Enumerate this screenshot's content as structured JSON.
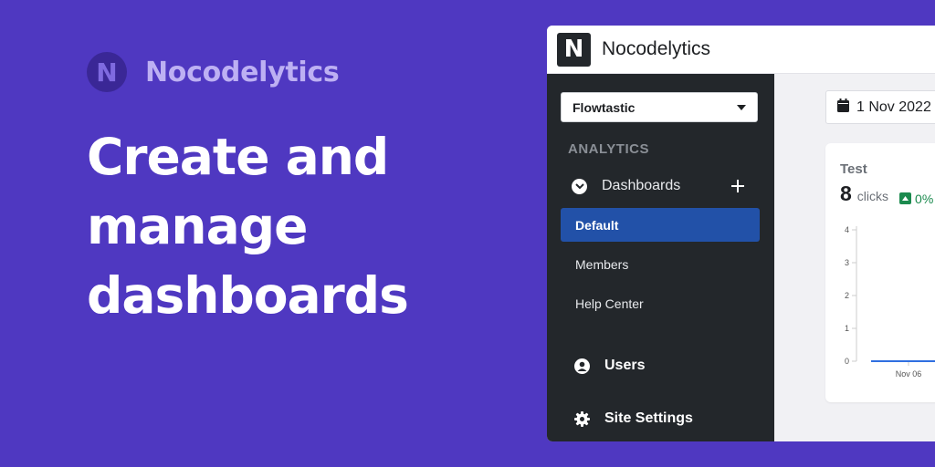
{
  "brand": {
    "logo_letter": "N",
    "name": "Nocodelytics"
  },
  "headline": {
    "lines": [
      "Create and",
      "manage",
      "dashboards"
    ]
  },
  "app": {
    "logo_letter": "N",
    "title": "Nocodelytics",
    "site_select": {
      "value": "Flowtastic"
    },
    "section_title": "ANALYTICS",
    "dashboards_label": "Dashboards",
    "nav": {
      "default": "Default",
      "members": "Members",
      "help_center": "Help Center"
    },
    "users_label": "Users",
    "site_settings_label": "Site Settings",
    "date_range": "1 Nov 2022",
    "card": {
      "title": "Test",
      "metric_value": "8",
      "metric_unit": "clicks",
      "change": "0%"
    }
  },
  "colors": {
    "background": "#4f38c1",
    "sidebar": "#23272b",
    "active": "#2251a8",
    "positive": "#1b8a4e"
  },
  "chart_data": {
    "type": "line",
    "x": [
      "Nov 06"
    ],
    "yticks": [
      "0",
      "1",
      "2",
      "3",
      "4"
    ],
    "ylim": [
      0,
      4
    ],
    "series": [
      {
        "values": [
          0
        ]
      }
    ]
  }
}
